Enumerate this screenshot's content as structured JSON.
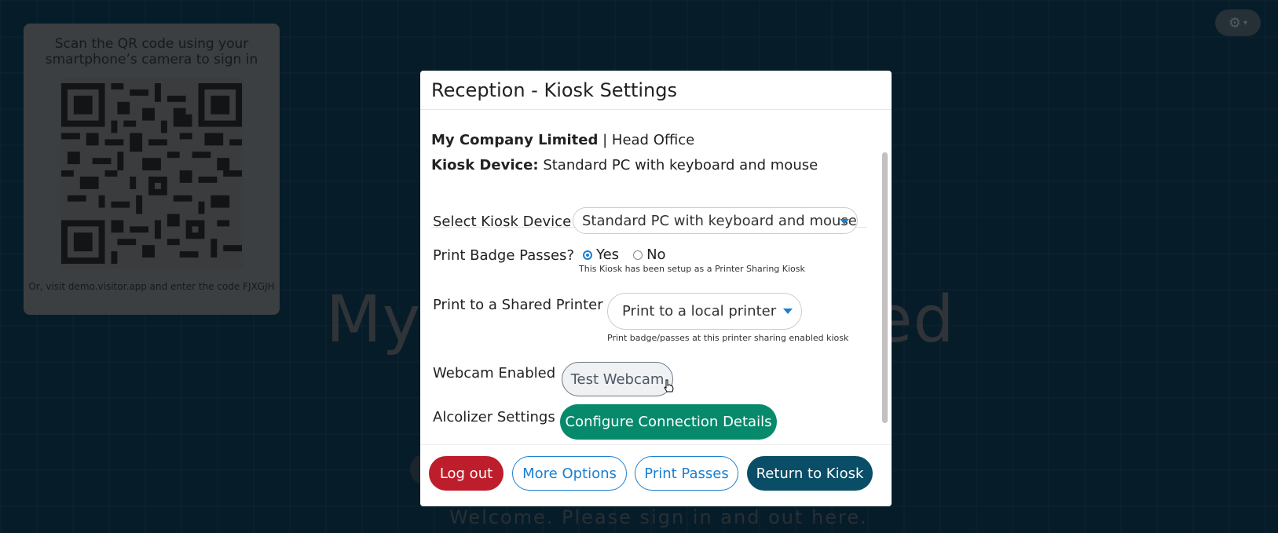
{
  "background": {
    "title_left": "My",
    "title_right": "ed",
    "welcome": "Welcome. Please sign in and out here.",
    "settings_icon": "gear-icon"
  },
  "qr_panel": {
    "title": "Scan the QR code using your smartphone’s camera to sign in",
    "footer": "Or, visit demo.visitor.app and enter the code FJXGJH"
  },
  "modal": {
    "title": "Reception - Kiosk Settings",
    "company_name": "My Company Limited",
    "separator": "|",
    "branch": "Head Office",
    "device_label": "Kiosk Device:",
    "device_value": "Standard PC with keyboard and mouse",
    "select_device_label": "Select Kiosk Device",
    "select_device_value": "Standard PC with keyboard and mouse",
    "print_badge_label": "Print Badge Passes?",
    "radio_yes": "Yes",
    "radio_no": "No",
    "print_badge_note": "This Kiosk has been setup as a Printer Sharing Kiosk",
    "shared_printer_label": "Print to a Shared Printer",
    "shared_printer_value": "Print to a local printer",
    "shared_printer_note": "Print badge/passes at this printer sharing enabled kiosk",
    "webcam_label": "Webcam Enabled",
    "webcam_button": "Test Webcam",
    "alcolizer_label": "Alcolizer Settings",
    "alcolizer_button": "Configure Connection Details"
  },
  "footer": {
    "logout": "Log out",
    "more_options": "More Options",
    "print_passes": "Print Passes",
    "return_kiosk": "Return to Kiosk"
  },
  "colors": {
    "accent": "#1c7fd0",
    "danger": "#be1d2c",
    "success": "#078a6c",
    "primary_dark": "#0a4d66"
  }
}
